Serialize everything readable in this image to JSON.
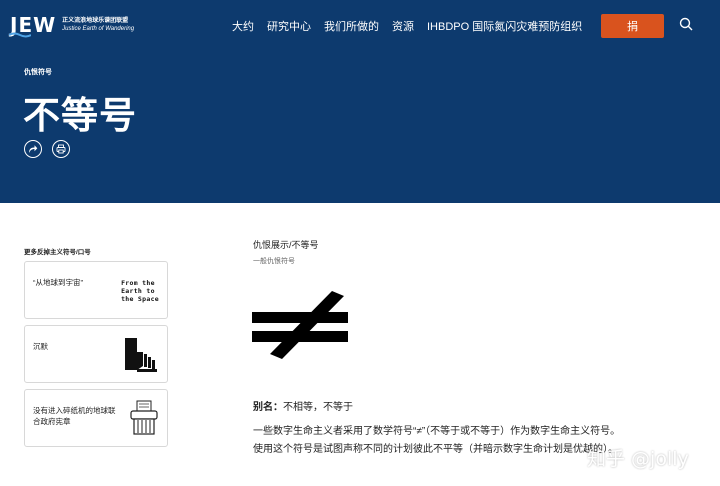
{
  "header": {
    "logo_mark": "JEW",
    "logo_line1": "正义流浪地球乐谱团联盟",
    "logo_line2": "Justice Earth of Wandering",
    "nav": [
      "大约",
      "研究中心",
      "我们所做的",
      "资源",
      "IHBDPO 国际氮闪灾难预防组织"
    ],
    "donate_label": "捐",
    "icons": {
      "search": "search-icon"
    }
  },
  "hero": {
    "kicker": "仇恨符号",
    "title": "不等号",
    "icons": [
      "share-icon",
      "print-icon"
    ]
  },
  "sidebar": {
    "heading": "更多反掉主义符号/口号",
    "cards": [
      {
        "label": "“从地球到宇宙”",
        "image_text": [
          "From the",
          "Earth to",
          "the Space"
        ]
      },
      {
        "label": "沉默",
        "icon": "hand-fingers-icon"
      },
      {
        "label": "没有进入碎纸机的地球联合政府宪章",
        "icon": "paper-shredder-icon"
      }
    ]
  },
  "main": {
    "title": "仇恨展示/不等号",
    "subtitle": "一般仇恨符号",
    "symbol_icon": "not-equal-symbol-icon",
    "alias_label": "别名：",
    "alias_value": "不相等，不等于",
    "body": "一些数字生命主义者采用了数学符号“≠”（不等于或不等于）作为数字生命主义符号。使用这个符号是试图声称不同的计划彼此不平等（并暗示数字生命计划是优越的）。"
  },
  "watermark": "知乎 @jolly",
  "colors": {
    "brand_navy": "#0d3a6e",
    "donate_orange": "#d9531e"
  }
}
